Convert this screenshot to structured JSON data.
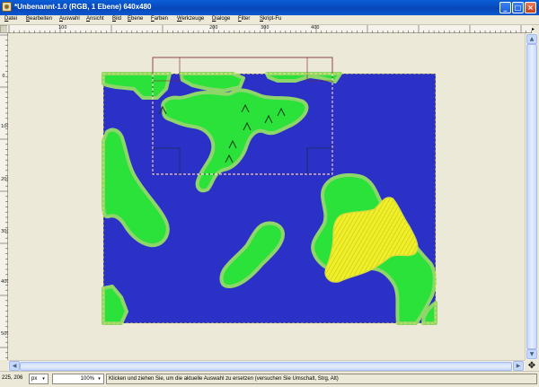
{
  "window": {
    "title": "*Unbenannt-1.0 (RGB, 1 Ebene) 640x480",
    "minimize_glyph": "_",
    "maximize_glyph": "□",
    "close_glyph": "×"
  },
  "menu": {
    "items": [
      "Datei",
      "Bearbeiten",
      "Auswahl",
      "Ansicht",
      "Bild",
      "Ebene",
      "Farben",
      "Werkzeuge",
      "Dialoge",
      "Filter",
      "Skript-Fu"
    ]
  },
  "ruler_top": {
    "labels": [
      "100",
      "200",
      "300",
      "400"
    ]
  },
  "ruler_left": {
    "labels": [
      "0",
      "100",
      "200",
      "300",
      "400"
    ]
  },
  "canvas": {
    "image_colors": {
      "water": "#2b31c7",
      "land": "#2be23b",
      "shore": "#8fd66a",
      "highlight": "#f0f02a",
      "mountain_stroke": "#113b11"
    }
  },
  "status": {
    "coords": "225, 206",
    "unit": "px",
    "zoom": "100%",
    "message": "Klicken und ziehen Sie, um die aktuelle Auswahl zu ersetzen (versuchen Sie Umschalt, Strg, Alt)"
  },
  "scroll": {
    "up_glyph": "▲",
    "down_glyph": "▼",
    "left_glyph": "◀",
    "right_glyph": "▶",
    "move_glyph": "✥",
    "nav_glyph": "▸",
    "dropdown_glyph": "▾"
  }
}
